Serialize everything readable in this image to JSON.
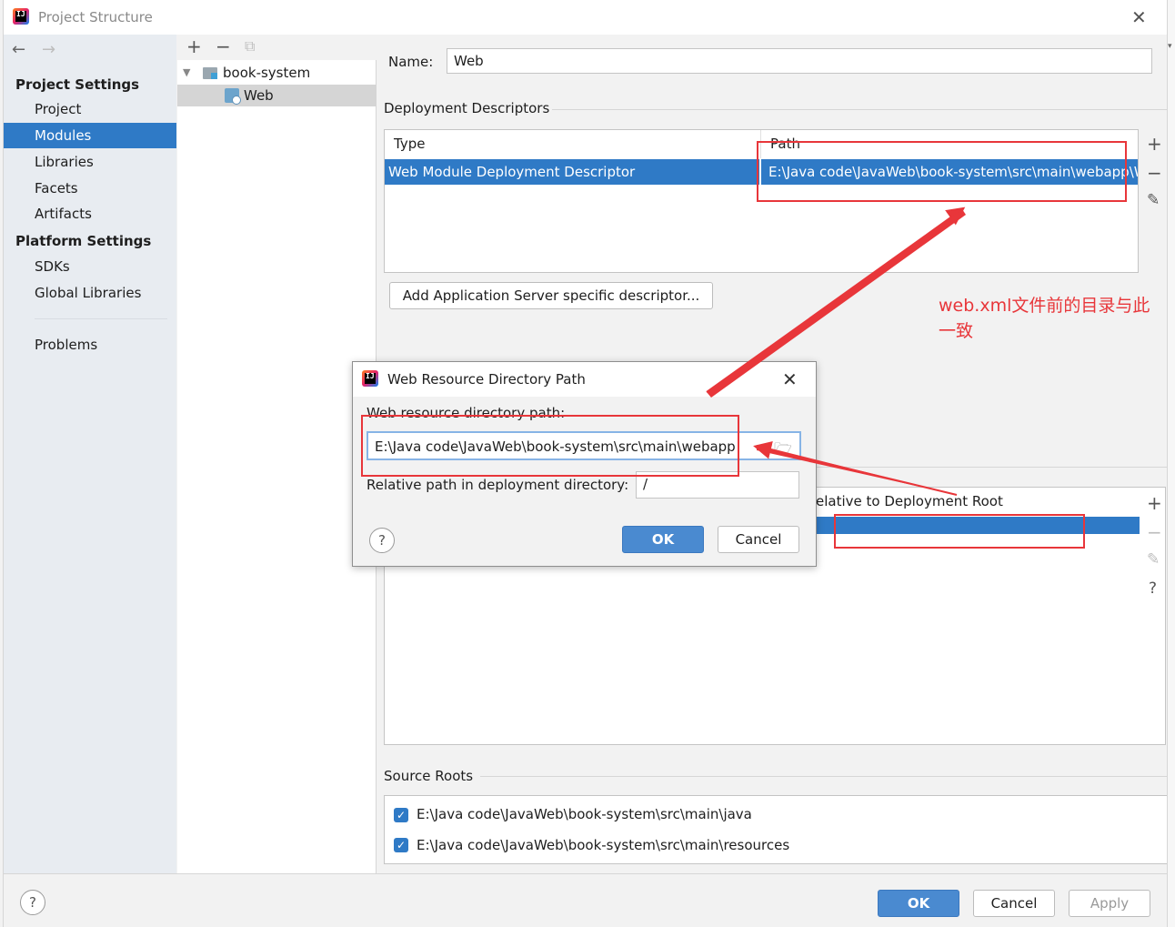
{
  "window": {
    "title": "Project Structure",
    "logo_text": "IJ"
  },
  "nav": {
    "project_settings_heading": "Project Settings",
    "project_settings_items": [
      "Project",
      "Modules",
      "Libraries",
      "Facets",
      "Artifacts"
    ],
    "platform_settings_heading": "Platform Settings",
    "platform_settings_items": [
      "SDKs",
      "Global Libraries"
    ],
    "problems": "Problems",
    "selected": "Modules"
  },
  "tree": {
    "root": "book-system",
    "child": "Web"
  },
  "module": {
    "name_label": "Name:",
    "name_value": "Web",
    "deployment_descriptors_heading": "Deployment Descriptors",
    "dd_col_type": "Type",
    "dd_col_path": "Path",
    "dd_row_type": "Web Module Deployment Descriptor",
    "dd_row_path": "E:\\Java code\\JavaWeb\\book-system\\src\\main\\webapp\\WEB-INF\\web.xml",
    "add_server_descriptor_button": "Add Application Server specific descriptor...",
    "web_resource_col_relative": "elative to Deployment Root",
    "source_roots_heading": "Source Roots",
    "source_roots": [
      "E:\\Java code\\JavaWeb\\book-system\\src\\main\\java",
      "E:\\Java code\\JavaWeb\\book-system\\src\\main\\resources"
    ]
  },
  "dialog": {
    "title": "Web Resource Directory Path",
    "path_label": "Web resource directory path:",
    "path_value": "E:\\Java code\\JavaWeb\\book-system\\src\\main\\webapp",
    "relative_label": "Relative path in deployment directory:",
    "relative_value": "/",
    "ok": "OK",
    "cancel": "Cancel"
  },
  "footer": {
    "ok": "OK",
    "cancel": "Cancel",
    "apply": "Apply"
  },
  "annotation": {
    "text": "web.xml文件前的目录与此一致",
    "line1": "web.xml文件前的目录与此",
    "line2": "一致",
    "color": "#e8363a"
  },
  "colors": {
    "selection": "#2f7ac6",
    "primary_button": "#4a8ad0"
  }
}
